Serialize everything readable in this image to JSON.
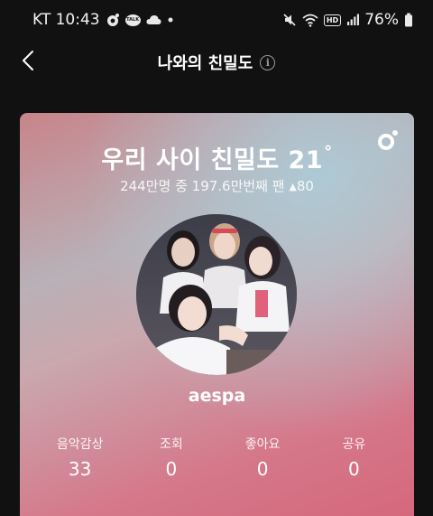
{
  "status_bar": {
    "carrier_time": "KT 10:43",
    "battery": "76%",
    "icons": [
      "melon-app-icon",
      "kakaotalk-icon",
      "cloud-icon",
      "dot-icon",
      "mute-icon",
      "wifi-icon",
      "hd-voice-icon",
      "signal-icon",
      "battery-icon"
    ],
    "talk_label": "TALK",
    "hd_label": "HD"
  },
  "header": {
    "title": "나와의 친밀도",
    "back_icon": "chevron-left-icon",
    "info_icon": "info-icon"
  },
  "card": {
    "title": "우리 사이 친밀도 21",
    "title_degree": "°",
    "subtitle": "244만명 중 197.6만번째 팬",
    "rank_change": "80",
    "rank_change_icon": "triangle-up-icon",
    "artist_name": "aespa",
    "stats": [
      {
        "label": "음악감상",
        "value": "33"
      },
      {
        "label": "조회",
        "value": "0"
      },
      {
        "label": "좋아요",
        "value": "0"
      },
      {
        "label": "공유",
        "value": "0"
      }
    ]
  },
  "colors": {
    "background": "#111111",
    "card_top": "#c8848a",
    "card_highlight": "#aad2de",
    "card_bottom": "#d5687c"
  }
}
